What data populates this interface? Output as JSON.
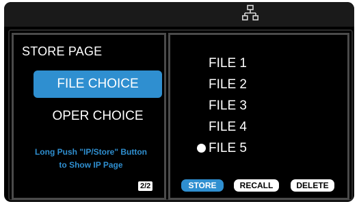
{
  "statusbar": {
    "network_icon": "network-icon"
  },
  "left_panel": {
    "title": "STORE PAGE",
    "menu": [
      {
        "label": "FILE CHOICE",
        "selected": true
      },
      {
        "label": "OPER CHOICE",
        "selected": false
      }
    ],
    "hint_line1": "Long Push \"IP/Store\" Button",
    "hint_line2": "to Show IP Page",
    "page_indicator": "2/2"
  },
  "right_panel": {
    "files": [
      {
        "label": "FILE 1",
        "active": false
      },
      {
        "label": "FILE 2",
        "active": false
      },
      {
        "label": "FILE 3",
        "active": false
      },
      {
        "label": "FILE 4",
        "active": false
      },
      {
        "label": "FILE 5",
        "active": true
      }
    ],
    "actions": {
      "store": "STORE",
      "recall": "RECALL",
      "delete": "DELETE"
    }
  },
  "colors": {
    "accent": "#2f8fd0",
    "background": "#000000",
    "text": "#ffffff"
  }
}
